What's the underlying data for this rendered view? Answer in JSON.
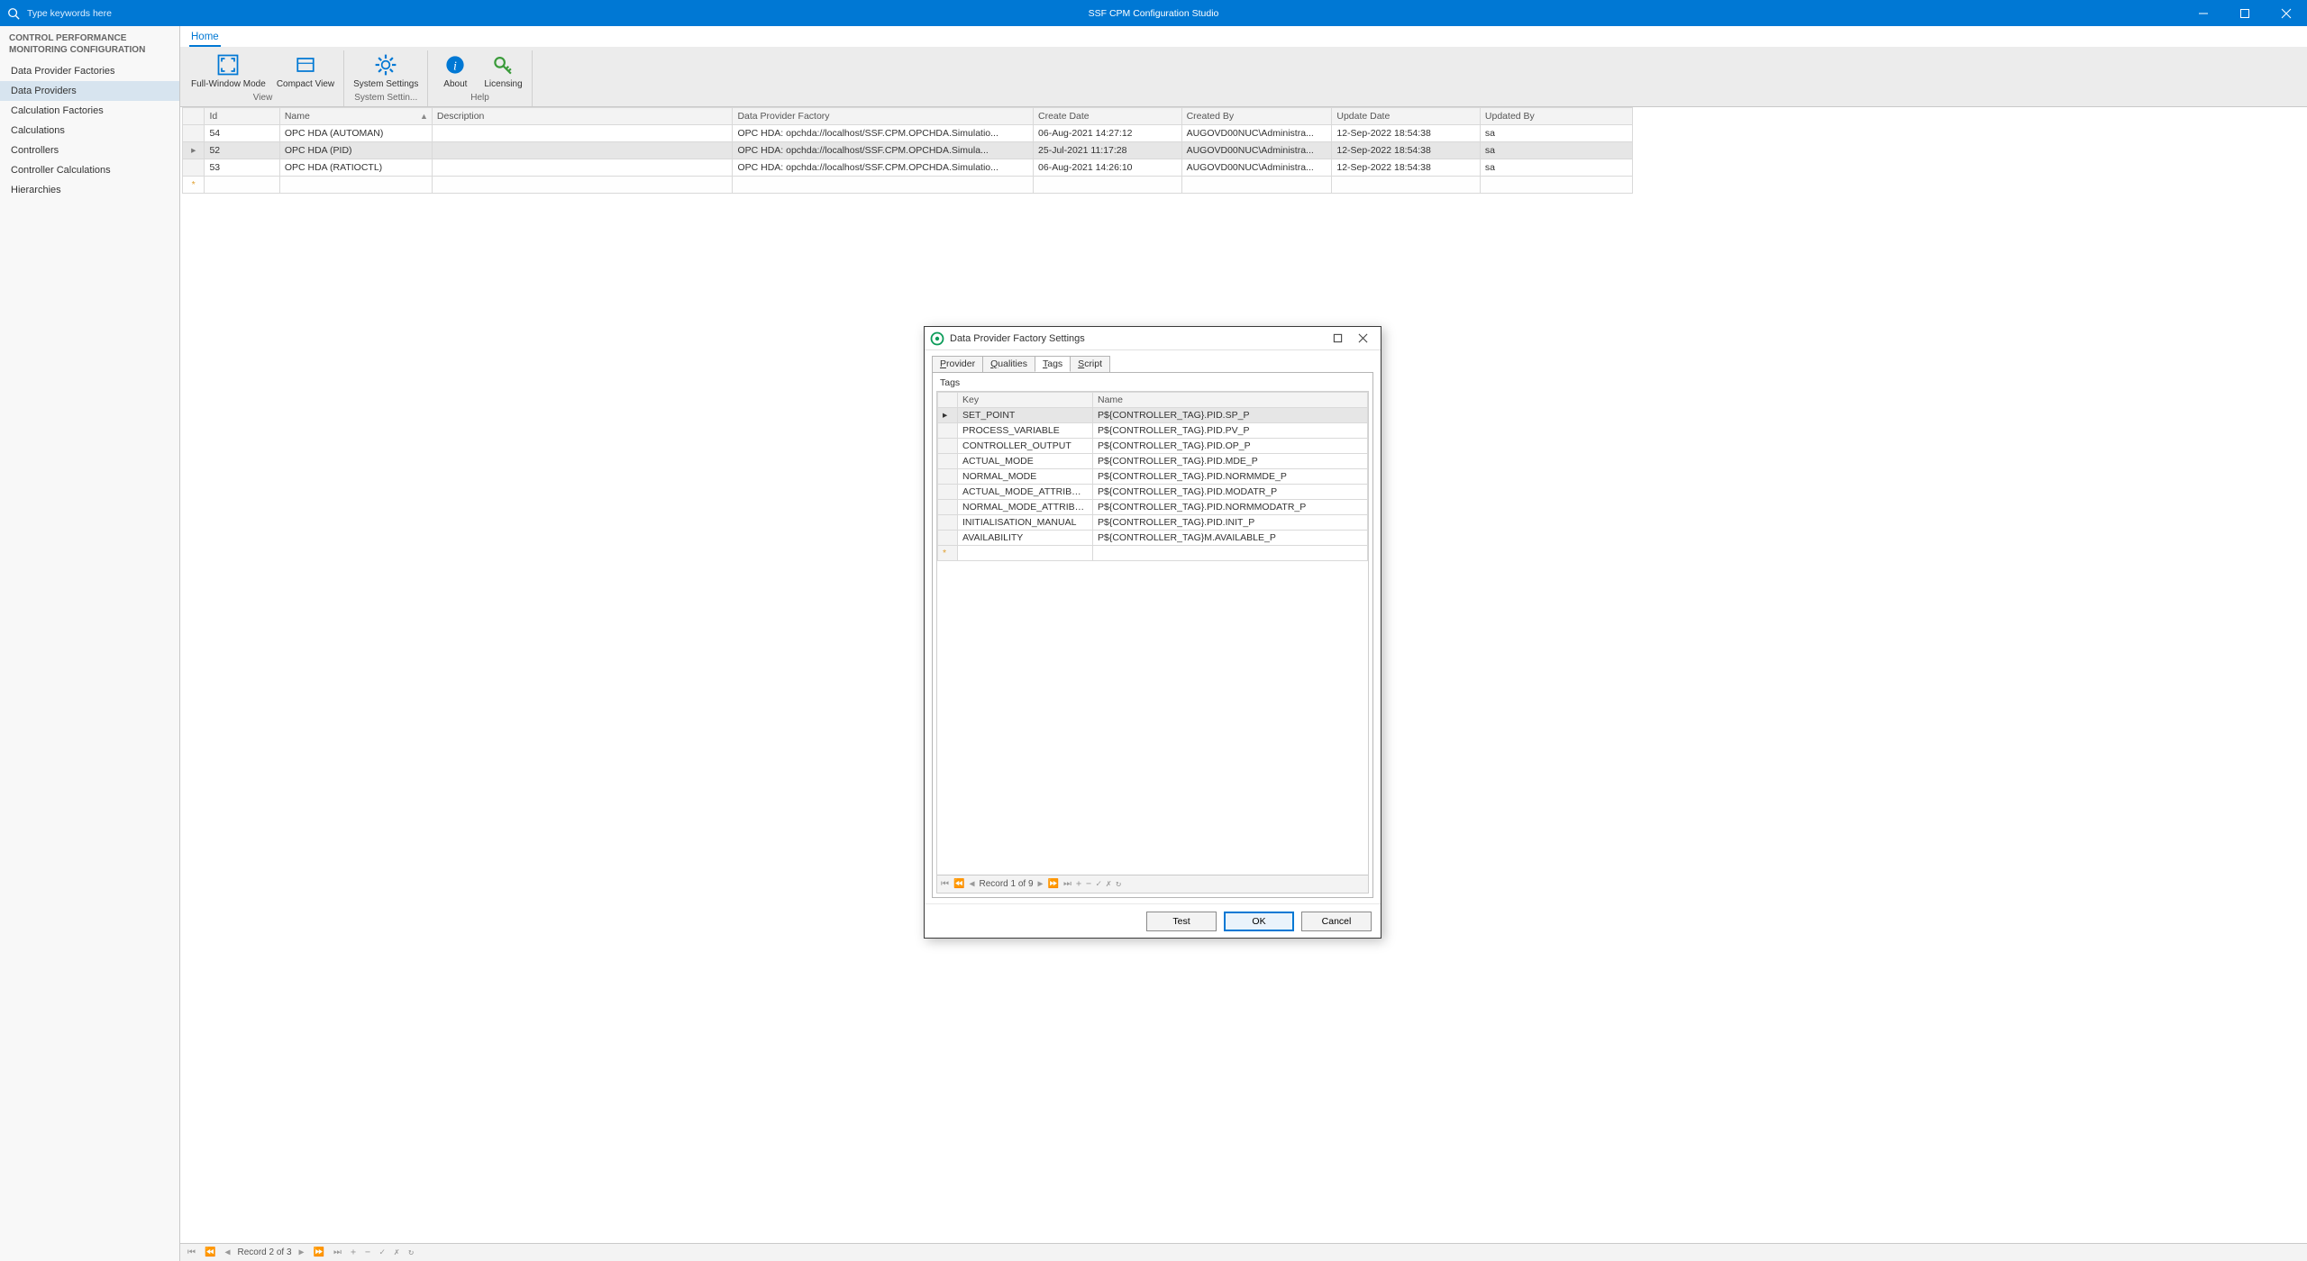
{
  "app": {
    "title": "SSF CPM Configuration Studio"
  },
  "search": {
    "placeholder": "Type keywords here"
  },
  "sidebar": {
    "heading": "CONTROL PERFORMANCE MONITORING CONFIGURATION",
    "items": [
      {
        "label": "Data Provider Factories"
      },
      {
        "label": "Data Providers"
      },
      {
        "label": "Calculation Factories"
      },
      {
        "label": "Calculations"
      },
      {
        "label": "Controllers"
      },
      {
        "label": "Controller Calculations"
      },
      {
        "label": "Hierarchies"
      }
    ],
    "selected_index": 1
  },
  "ribbon": {
    "tab": "Home",
    "groups": {
      "view": {
        "label": "View",
        "buttons": [
          {
            "label": "Full-Window Mode"
          },
          {
            "label": "Compact View"
          }
        ]
      },
      "settings": {
        "label": "System Settin...",
        "buttons": [
          {
            "label": "System Settings"
          }
        ]
      },
      "help": {
        "label": "Help",
        "buttons": [
          {
            "label": "About"
          },
          {
            "label": "Licensing"
          }
        ]
      }
    }
  },
  "grid": {
    "columns": [
      "Id",
      "Name",
      "Description",
      "Data Provider Factory",
      "Create Date",
      "Created By",
      "Update Date",
      "Updated By"
    ],
    "rows": [
      {
        "id": "54",
        "name": "OPC HDA (AUTOMAN)",
        "desc": "",
        "factory": "OPC HDA: opchda://localhost/SSF.CPM.OPCHDA.Simulatio...",
        "create": "06-Aug-2021 14:27:12",
        "created_by": "AUGOVD00NUC\\Administra...",
        "update": "12-Sep-2022 18:54:38",
        "updated_by": "sa"
      },
      {
        "id": "52",
        "name": "OPC HDA (PID)",
        "desc": "",
        "factory": "OPC HDA: opchda://localhost/SSF.CPM.OPCHDA.Simula...",
        "create": "25-Jul-2021 11:17:28",
        "created_by": "AUGOVD00NUC\\Administra...",
        "update": "12-Sep-2022 18:54:38",
        "updated_by": "sa"
      },
      {
        "id": "53",
        "name": "OPC HDA (RATIOCTL)",
        "desc": "",
        "factory": "OPC HDA: opchda://localhost/SSF.CPM.OPCHDA.Simulatio...",
        "create": "06-Aug-2021 14:26:10",
        "created_by": "AUGOVD00NUC\\Administra...",
        "update": "12-Sep-2022 18:54:38",
        "updated_by": "sa"
      }
    ],
    "selected_index": 1,
    "status": "Record 2 of 3"
  },
  "modal": {
    "title": "Data Provider Factory Settings",
    "tabs": [
      "Provider",
      "Qualities",
      "Tags",
      "Script"
    ],
    "active_tab": 2,
    "panel_label": "Tags",
    "columns": [
      "Key",
      "Name"
    ],
    "rows": [
      {
        "key": "SET_POINT",
        "name": "P${CONTROLLER_TAG}.PID.SP_P"
      },
      {
        "key": "PROCESS_VARIABLE",
        "name": "P${CONTROLLER_TAG}.PID.PV_P"
      },
      {
        "key": "CONTROLLER_OUTPUT",
        "name": "P${CONTROLLER_TAG}.PID.OP_P"
      },
      {
        "key": "ACTUAL_MODE",
        "name": "P${CONTROLLER_TAG}.PID.MDE_P"
      },
      {
        "key": "NORMAL_MODE",
        "name": "P${CONTROLLER_TAG}.PID.NORMMDE_P"
      },
      {
        "key": "ACTUAL_MODE_ATTRIBUTE",
        "name": "P${CONTROLLER_TAG}.PID.MODATR_P"
      },
      {
        "key": "NORMAL_MODE_ATTRIBUTE",
        "name": "P${CONTROLLER_TAG}.PID.NORMMODATR_P"
      },
      {
        "key": "INITIALISATION_MANUAL",
        "name": "P${CONTROLLER_TAG}.PID.INIT_P"
      },
      {
        "key": "AVAILABILITY",
        "name": "P${CONTROLLER_TAG}M.AVAILABLE_P"
      }
    ],
    "selected_index": 0,
    "status": "Record 1 of 9",
    "buttons": {
      "test": "Test",
      "ok": "OK",
      "cancel": "Cancel"
    }
  }
}
